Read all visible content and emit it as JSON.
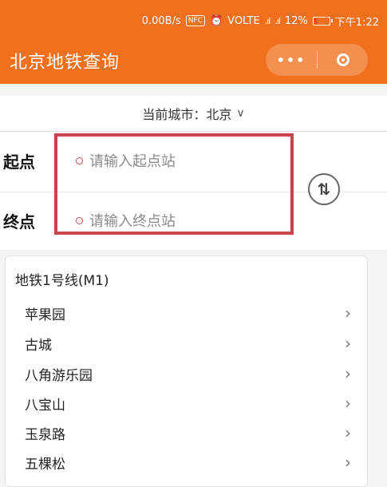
{
  "status_bar": {
    "speed": "0.00B/s",
    "nfc": "NFC",
    "volte": "VOLTE",
    "battery": "12%",
    "time": "下午1:22"
  },
  "header": {
    "title": "北京地铁查询",
    "more_label": "•••"
  },
  "city": {
    "label": "当前城市：北京",
    "chevron_icon": "chevron-down-icon"
  },
  "form": {
    "start_label": "起点",
    "start_placeholder": "请输入起点站",
    "end_label": "终点",
    "end_placeholder": "请输入终点站",
    "swap_icon": "swap-vertical-icon",
    "highlight_color": "#c8454b"
  },
  "line": {
    "name": "地铁1号线(M1)",
    "stations": [
      "苹果园",
      "古城",
      "八角游乐园",
      "八宝山",
      "玉泉路",
      "五棵松"
    ]
  },
  "colors": {
    "header_bg": "#f0701e",
    "page_bg": "#f4f4f4"
  }
}
